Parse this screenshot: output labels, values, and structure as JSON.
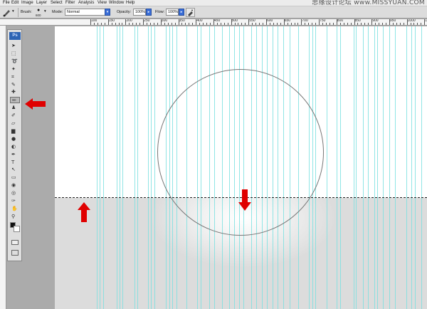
{
  "menubar": {
    "items": [
      "File",
      "Edit",
      "Image",
      "Layer",
      "Select",
      "Filter",
      "Analysis",
      "View",
      "Window",
      "Help"
    ]
  },
  "watermark": "思缘设计论坛 www.MISSYUAN.COM",
  "options": {
    "brush_label": "Brush:",
    "brush_size": "600",
    "mode_label": "Mode:",
    "mode_value": "Normal",
    "opacity_label": "Opacity:",
    "opacity_value": "100%",
    "flow_label": "Flow:",
    "flow_value": "100%"
  },
  "ruler": {
    "labels": [
      "100",
      "150",
      "200",
      "250",
      "300",
      "350",
      "400",
      "450",
      "500",
      "550",
      "600",
      "650",
      "700",
      "750",
      "800",
      "850",
      "900",
      "950",
      "1000",
      "1050"
    ]
  },
  "toolbox": {
    "logo": "Ps",
    "tools": [
      {
        "name": "move-tool-icon",
        "glyph": "➤"
      },
      {
        "name": "marquee-tool-icon",
        "glyph": "⬚"
      },
      {
        "name": "lasso-tool-icon",
        "glyph": "➰"
      },
      {
        "name": "magic-wand-tool-icon",
        "glyph": "✦"
      },
      {
        "name": "crop-tool-icon",
        "glyph": "⌗"
      },
      {
        "name": "slice-tool-icon",
        "glyph": "✎"
      },
      {
        "name": "healing-tool-icon",
        "glyph": "✚"
      },
      {
        "name": "brush-tool-icon",
        "glyph": "✏"
      },
      {
        "name": "stamp-tool-icon",
        "glyph": "♟"
      },
      {
        "name": "history-brush-tool-icon",
        "glyph": "✐"
      },
      {
        "name": "eraser-tool-icon",
        "glyph": "▱"
      },
      {
        "name": "gradient-tool-icon",
        "glyph": "▆"
      },
      {
        "name": "blur-tool-icon",
        "glyph": "●"
      },
      {
        "name": "dodge-tool-icon",
        "glyph": "◐"
      },
      {
        "name": "pen-tool-icon",
        "glyph": "✒"
      },
      {
        "name": "type-tool-icon",
        "glyph": "T"
      },
      {
        "name": "path-selection-tool-icon",
        "glyph": "↖"
      },
      {
        "name": "shape-tool-icon",
        "glyph": "▭"
      },
      {
        "name": "3d-rotate-tool-icon",
        "glyph": "◉"
      },
      {
        "name": "3d-orbit-tool-icon",
        "glyph": "◎"
      },
      {
        "name": "eyedropper-tool-icon",
        "glyph": "✑"
      },
      {
        "name": "hand-tool-icon",
        "glyph": "✋"
      },
      {
        "name": "zoom-tool-icon",
        "glyph": "⚲"
      }
    ],
    "active_tool_index": 7
  }
}
